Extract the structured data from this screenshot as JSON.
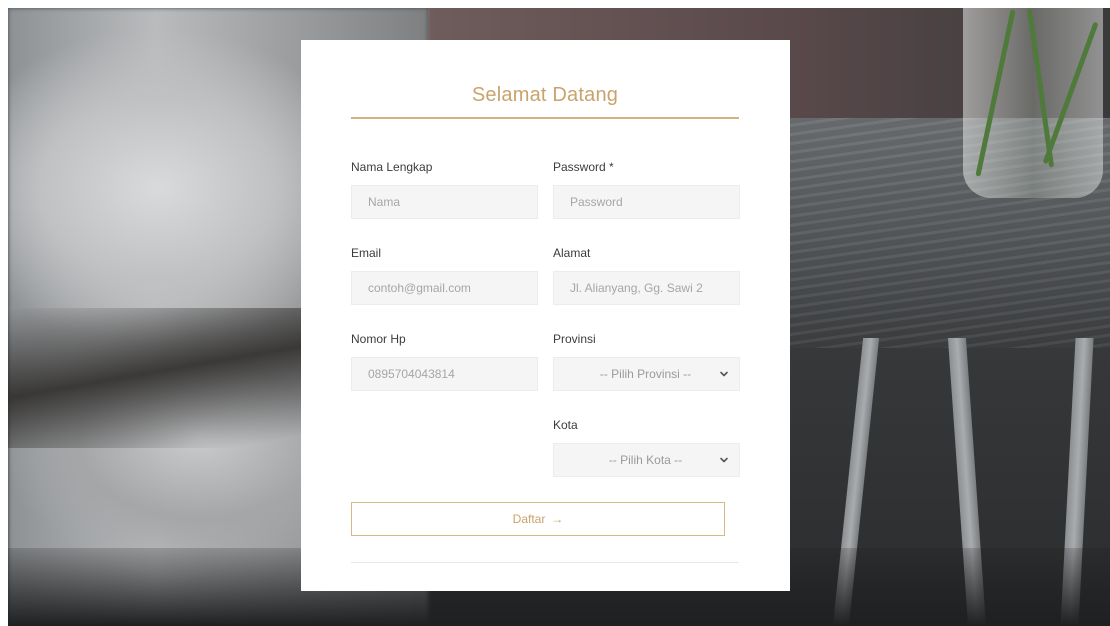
{
  "form": {
    "title": "Selamat Datang",
    "fields": {
      "nama": {
        "label": "Nama Lengkap",
        "placeholder": "Nama",
        "value": ""
      },
      "password": {
        "label": "Password *",
        "placeholder": "Password",
        "value": ""
      },
      "email": {
        "label": "Email",
        "placeholder": "contoh@gmail.com",
        "value": ""
      },
      "alamat": {
        "label": "Alamat",
        "placeholder": "Jl. Alianyang, Gg. Sawi 2",
        "value": ""
      },
      "nomor_hp": {
        "label": "Nomor Hp",
        "placeholder": "0895704043814",
        "value": ""
      },
      "provinsi": {
        "label": "Provinsi",
        "selected": "-- Pilih Provinsi --"
      },
      "kota": {
        "label": "Kota",
        "selected": "-- Pilih Kota --"
      }
    },
    "submit": {
      "label": "Daftar",
      "arrow": "→"
    }
  },
  "icons": {
    "select_arrow": "chevron-down-icon",
    "submit_arrow": "arrow-right-icon"
  },
  "colors": {
    "accent": "#c9a36b",
    "field_bg": "#f5f5f5",
    "card_bg": "#ffffff"
  }
}
